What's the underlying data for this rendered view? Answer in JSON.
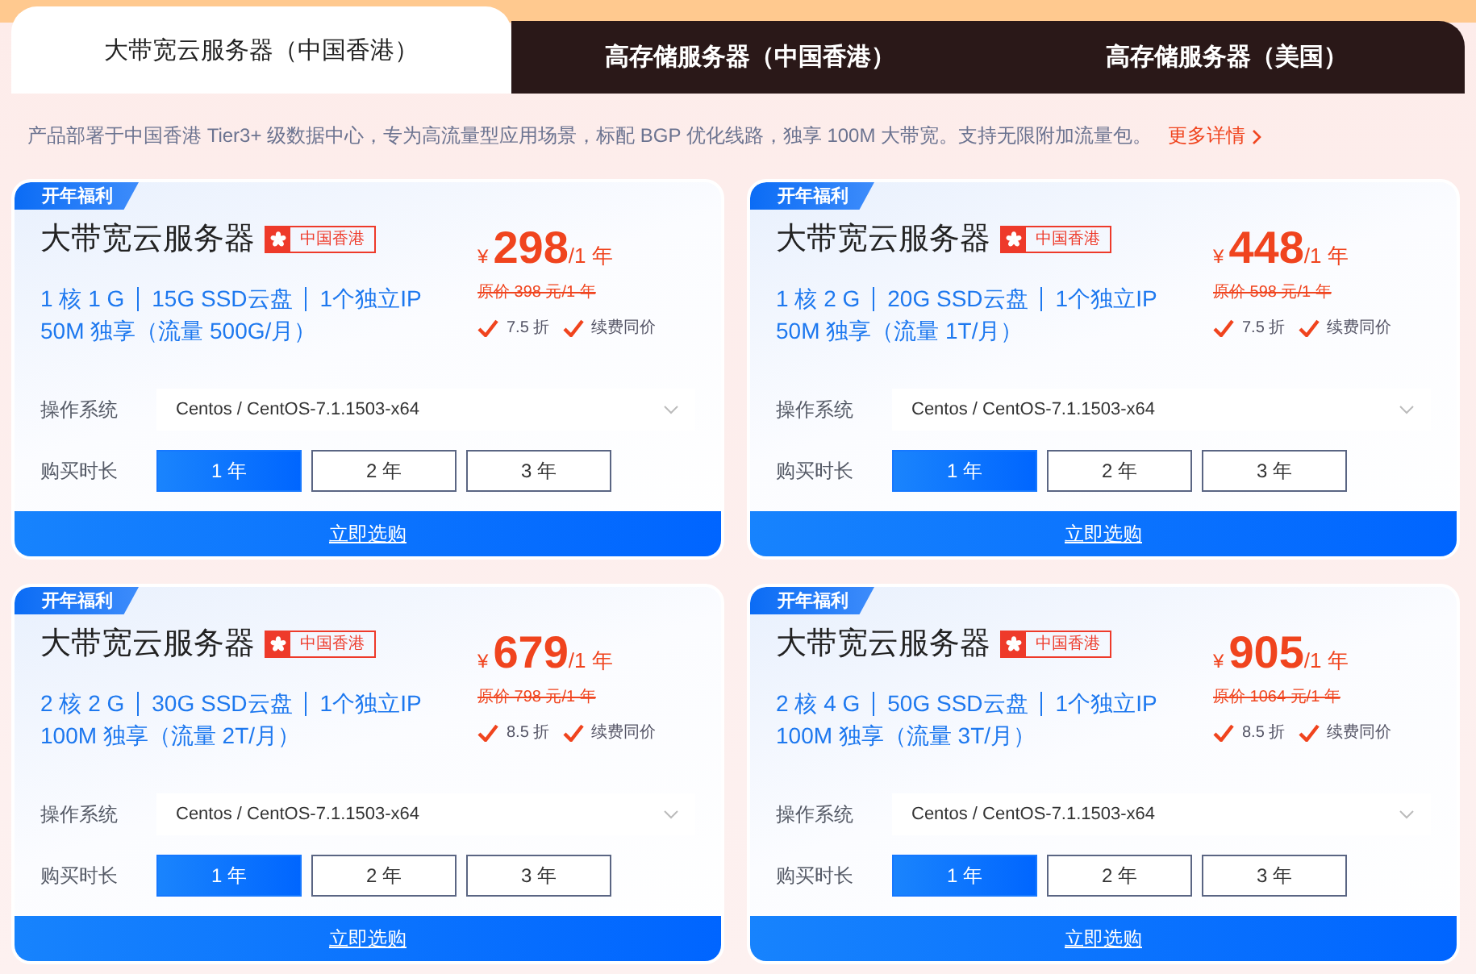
{
  "tabs": [
    {
      "label": "大带宽云服务器（中国香港）",
      "selected": true
    },
    {
      "label": "高存储服务器（中国香港）",
      "selected": false
    },
    {
      "label": "高存储服务器（美国）",
      "selected": false
    }
  ],
  "notice": {
    "text": "产品部署于中国香港 Tier3+ 级数据中心，专为高流量型应用场景，标配 BGP 优化线路，独享 100M 大带宽。支持无限附加流量包。",
    "link": "更多详情"
  },
  "cards": [
    {
      "badge": "开年福利",
      "title": "大带宽云服务器",
      "region": "中国香港",
      "specs": [
        "1 核 1 G",
        "15G SSD云盘",
        "1个独立IP"
      ],
      "bandwidth": "50M 独享（流量 500G/月）",
      "currency": "¥",
      "price": "298",
      "unit": "/1 年",
      "original": "原价 398 元/1 年",
      "perks": [
        "7.5 折",
        "续费同价"
      ],
      "os_label": "操作系统",
      "os_value": "Centos / CentOS-7.1.1503-x64",
      "duration_label": "购买时长",
      "durations": [
        {
          "label": "1 年",
          "selected": true
        },
        {
          "label": "2 年",
          "selected": false
        },
        {
          "label": "3 年",
          "selected": false
        }
      ],
      "action": "立即选购"
    },
    {
      "badge": "开年福利",
      "title": "大带宽云服务器",
      "region": "中国香港",
      "specs": [
        "1 核 2 G",
        "20G SSD云盘",
        "1个独立IP"
      ],
      "bandwidth": "50M 独享（流量 1T/月）",
      "currency": "¥",
      "price": "448",
      "unit": "/1 年",
      "original": "原价 598 元/1 年",
      "perks": [
        "7.5 折",
        "续费同价"
      ],
      "os_label": "操作系统",
      "os_value": "Centos / CentOS-7.1.1503-x64",
      "duration_label": "购买时长",
      "durations": [
        {
          "label": "1 年",
          "selected": true
        },
        {
          "label": "2 年",
          "selected": false
        },
        {
          "label": "3 年",
          "selected": false
        }
      ],
      "action": "立即选购"
    },
    {
      "badge": "开年福利",
      "title": "大带宽云服务器",
      "region": "中国香港",
      "specs": [
        "2 核 2 G",
        "30G SSD云盘",
        "1个独立IP"
      ],
      "bandwidth": "100M 独享（流量 2T/月）",
      "currency": "¥",
      "price": "679",
      "unit": "/1 年",
      "original": "原价 798 元/1 年",
      "perks": [
        "8.5 折",
        "续费同价"
      ],
      "os_label": "操作系统",
      "os_value": "Centos / CentOS-7.1.1503-x64",
      "duration_label": "购买时长",
      "durations": [
        {
          "label": "1 年",
          "selected": true
        },
        {
          "label": "2 年",
          "selected": false
        },
        {
          "label": "3 年",
          "selected": false
        }
      ],
      "action": "立即选购"
    },
    {
      "badge": "开年福利",
      "title": "大带宽云服务器",
      "region": "中国香港",
      "specs": [
        "2 核 4 G",
        "50G SSD云盘",
        "1个独立IP"
      ],
      "bandwidth": "100M 独享（流量 3T/月）",
      "currency": "¥",
      "price": "905",
      "unit": "/1 年",
      "original": "原价 1064 元/1 年",
      "perks": [
        "8.5 折",
        "续费同价"
      ],
      "os_label": "操作系统",
      "os_value": "Centos / CentOS-7.1.1503-x64",
      "duration_label": "购买时长",
      "durations": [
        {
          "label": "1 年",
          "selected": true
        },
        {
          "label": "2 年",
          "selected": false
        },
        {
          "label": "3 年",
          "selected": false
        }
      ],
      "action": "立即选购"
    }
  ]
}
